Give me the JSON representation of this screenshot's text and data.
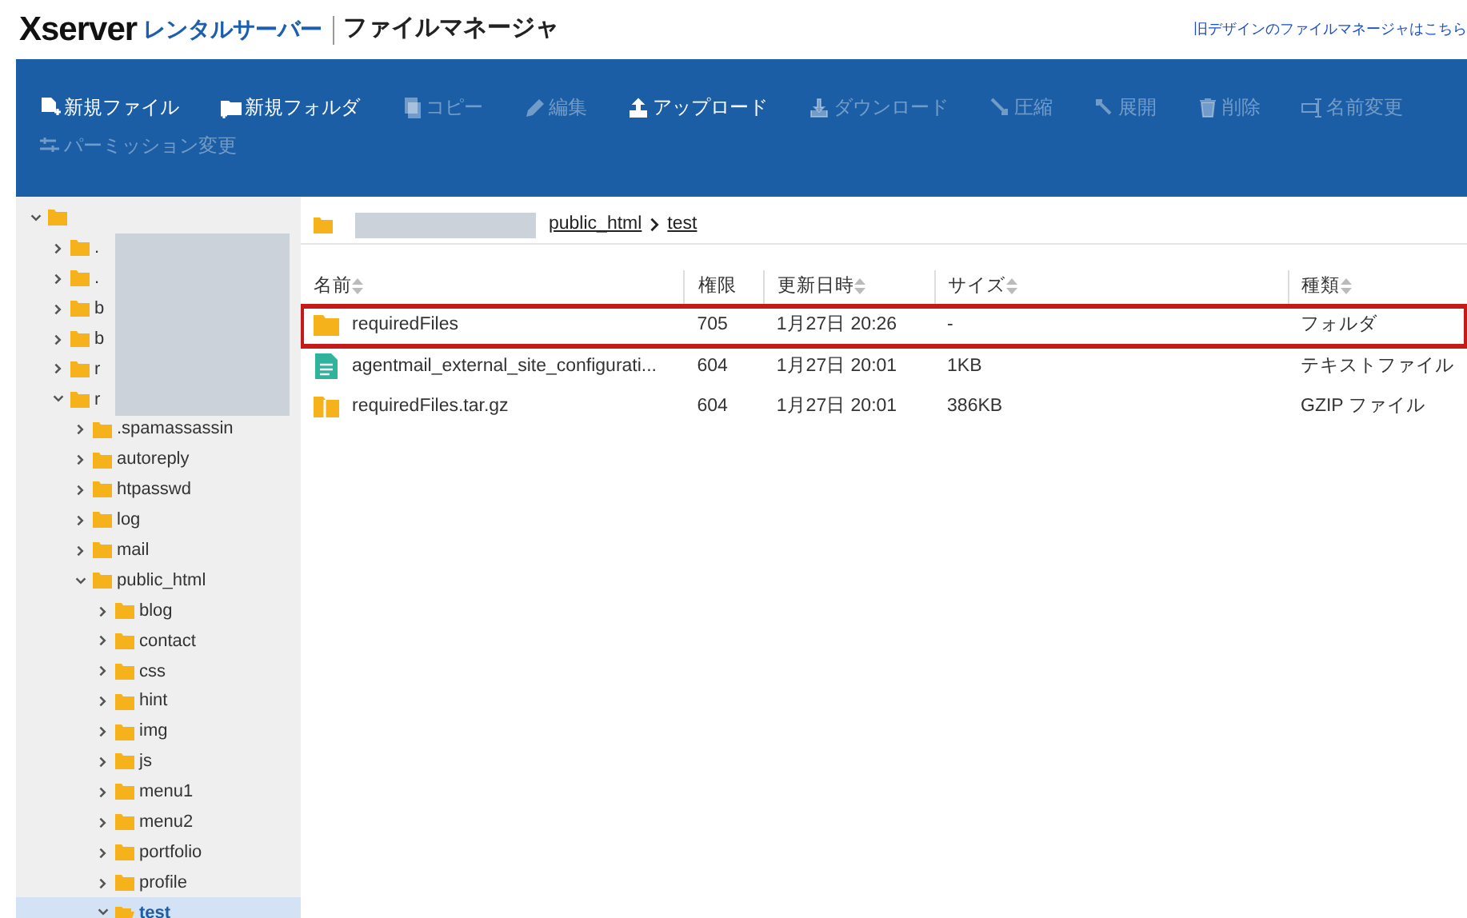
{
  "header": {
    "logo": "Xserver",
    "service": "レンタルサーバー",
    "title": "ファイルマネージャ",
    "old_design_link": "旧デザインのファイルマネージャはこちら"
  },
  "toolbar": [
    {
      "kind": "new-file",
      "label": "新規ファイル",
      "disabled": false
    },
    {
      "kind": "new-folder",
      "label": "新規フォルダ",
      "disabled": false
    },
    {
      "kind": "copy",
      "label": "コピー",
      "disabled": true
    },
    {
      "kind": "edit",
      "label": "編集",
      "disabled": true
    },
    {
      "kind": "upload",
      "label": "アップロード",
      "disabled": false
    },
    {
      "kind": "download",
      "label": "ダウンロード",
      "disabled": true
    },
    {
      "kind": "compress",
      "label": "圧縮",
      "disabled": true
    },
    {
      "kind": "extract",
      "label": "展開",
      "disabled": true
    },
    {
      "kind": "delete",
      "label": "削除",
      "disabled": true
    },
    {
      "kind": "rename",
      "label": "名前変更",
      "disabled": true
    },
    {
      "kind": "permission",
      "label": "パーミッション変更",
      "disabled": true
    }
  ],
  "tree": {
    "expanded": true,
    "selected": false,
    "children": [
      {
        "label": ".",
        "expanded": false,
        "selected": false
      },
      {
        "label": ".",
        "expanded": false,
        "selected": false
      },
      {
        "label": "b",
        "expanded": false,
        "selected": false
      },
      {
        "label": "b",
        "expanded": false,
        "selected": false
      },
      {
        "label": "r",
        "expanded": false,
        "selected": false
      },
      {
        "label": "r",
        "expanded": true,
        "selected": false,
        "children": [
          {
            "label": ".spamassassin",
            "expanded": false,
            "selected": false
          },
          {
            "label": "autoreply",
            "expanded": false,
            "selected": false
          },
          {
            "label": "htpasswd",
            "expanded": false,
            "selected": false
          },
          {
            "label": "log",
            "expanded": false,
            "selected": false
          },
          {
            "label": "mail",
            "expanded": false,
            "selected": false
          },
          {
            "label": "public_html",
            "expanded": true,
            "selected": false,
            "children": [
              {
                "label": "blog",
                "expanded": false,
                "selected": false
              },
              {
                "label": "contact",
                "expanded": false,
                "selected": false
              },
              {
                "label": "css",
                "expanded": false,
                "selected": false
              },
              {
                "label": "hint",
                "expanded": false,
                "selected": false
              },
              {
                "label": "img",
                "expanded": false,
                "selected": false
              },
              {
                "label": "js",
                "expanded": false,
                "selected": false
              },
              {
                "label": "menu1",
                "expanded": false,
                "selected": false
              },
              {
                "label": "menu2",
                "expanded": false,
                "selected": false
              },
              {
                "label": "portfolio",
                "expanded": false,
                "selected": false
              },
              {
                "label": "profile",
                "expanded": false,
                "selected": false
              },
              {
                "label": "test",
                "expanded": true,
                "selected": true
              }
            ]
          }
        ]
      }
    ]
  },
  "breadcrumb": [
    "public_html",
    "test"
  ],
  "table": {
    "columns": [
      "名前",
      "権限",
      "更新日時",
      "サイズ",
      "種類"
    ],
    "rows": [
      {
        "kind": "folder",
        "name": "requiredFiles",
        "permission": "705",
        "modified": "1月27日 20:26",
        "size": "-",
        "type": "フォルダ",
        "highlighted": true
      },
      {
        "kind": "text",
        "name": "agentmail_external_site_configurati...",
        "permission": "604",
        "modified": "1月27日 20:01",
        "size": "1KB",
        "type": "テキストファイル",
        "highlighted": false
      },
      {
        "kind": "archive",
        "name": "requiredFiles.tar.gz",
        "permission": "604",
        "modified": "1月27日 20:01",
        "size": "386KB",
        "type": "GZIP ファイル",
        "highlighted": false
      }
    ]
  }
}
